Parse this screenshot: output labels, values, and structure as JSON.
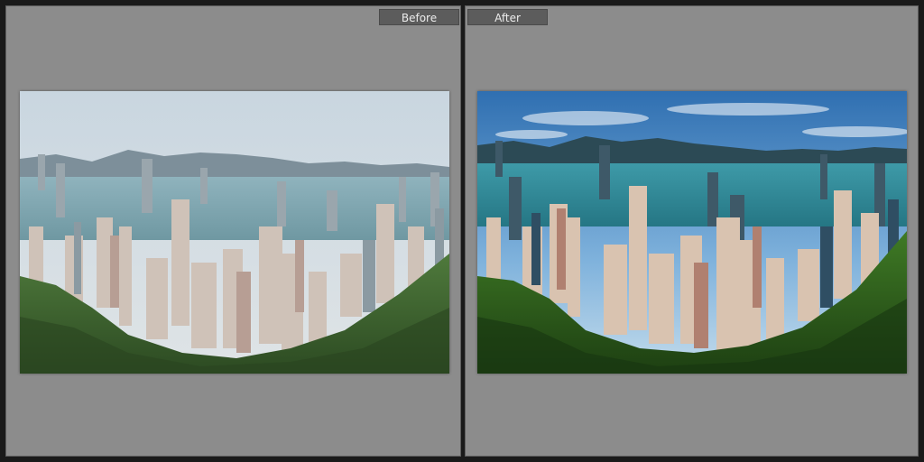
{
  "compare_view": {
    "before": {
      "label": "Before"
    },
    "after": {
      "label": "After"
    }
  },
  "colors": {
    "panel_bg": "#8c8c8c",
    "label_bg": "#5c5c5c",
    "frame_bg": "#1a1a1a"
  }
}
